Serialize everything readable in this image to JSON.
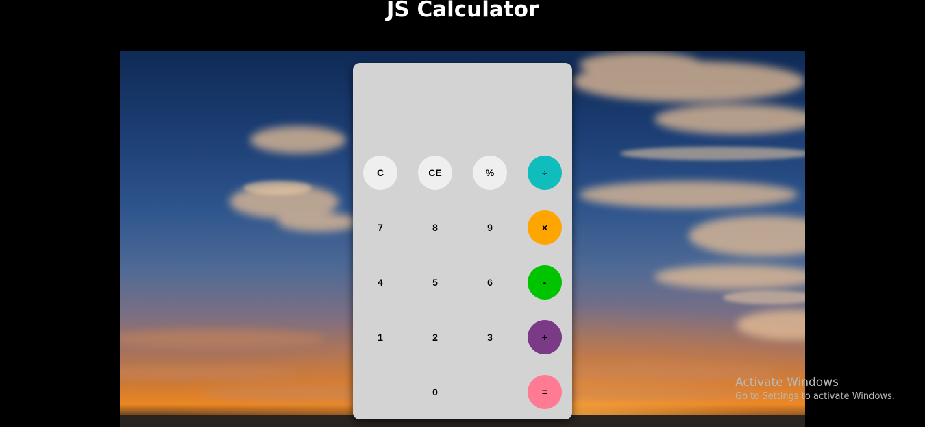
{
  "page": {
    "title": "JS Calculator"
  },
  "calculator": {
    "display_value": "",
    "buttons": {
      "clear": "C",
      "clear_entry": "CE",
      "percent": "%",
      "divide": "÷",
      "seven": "7",
      "eight": "8",
      "nine": "9",
      "multiply": "×",
      "four": "4",
      "five": "5",
      "six": "6",
      "subtract": "-",
      "one": "1",
      "two": "2",
      "three": "3",
      "add": "+",
      "zero": "0",
      "equals": "="
    },
    "colors": {
      "body": "#d3d3d3",
      "light_button": "#efefef",
      "divide": "#0fbdbd",
      "multiply": "#ffa500",
      "subtract": "#00c400",
      "add": "#7b3a86",
      "equals": "#ff7b93"
    }
  },
  "watermark": {
    "line1": "Activate Windows",
    "line2": "Go to Settings to activate Windows."
  }
}
